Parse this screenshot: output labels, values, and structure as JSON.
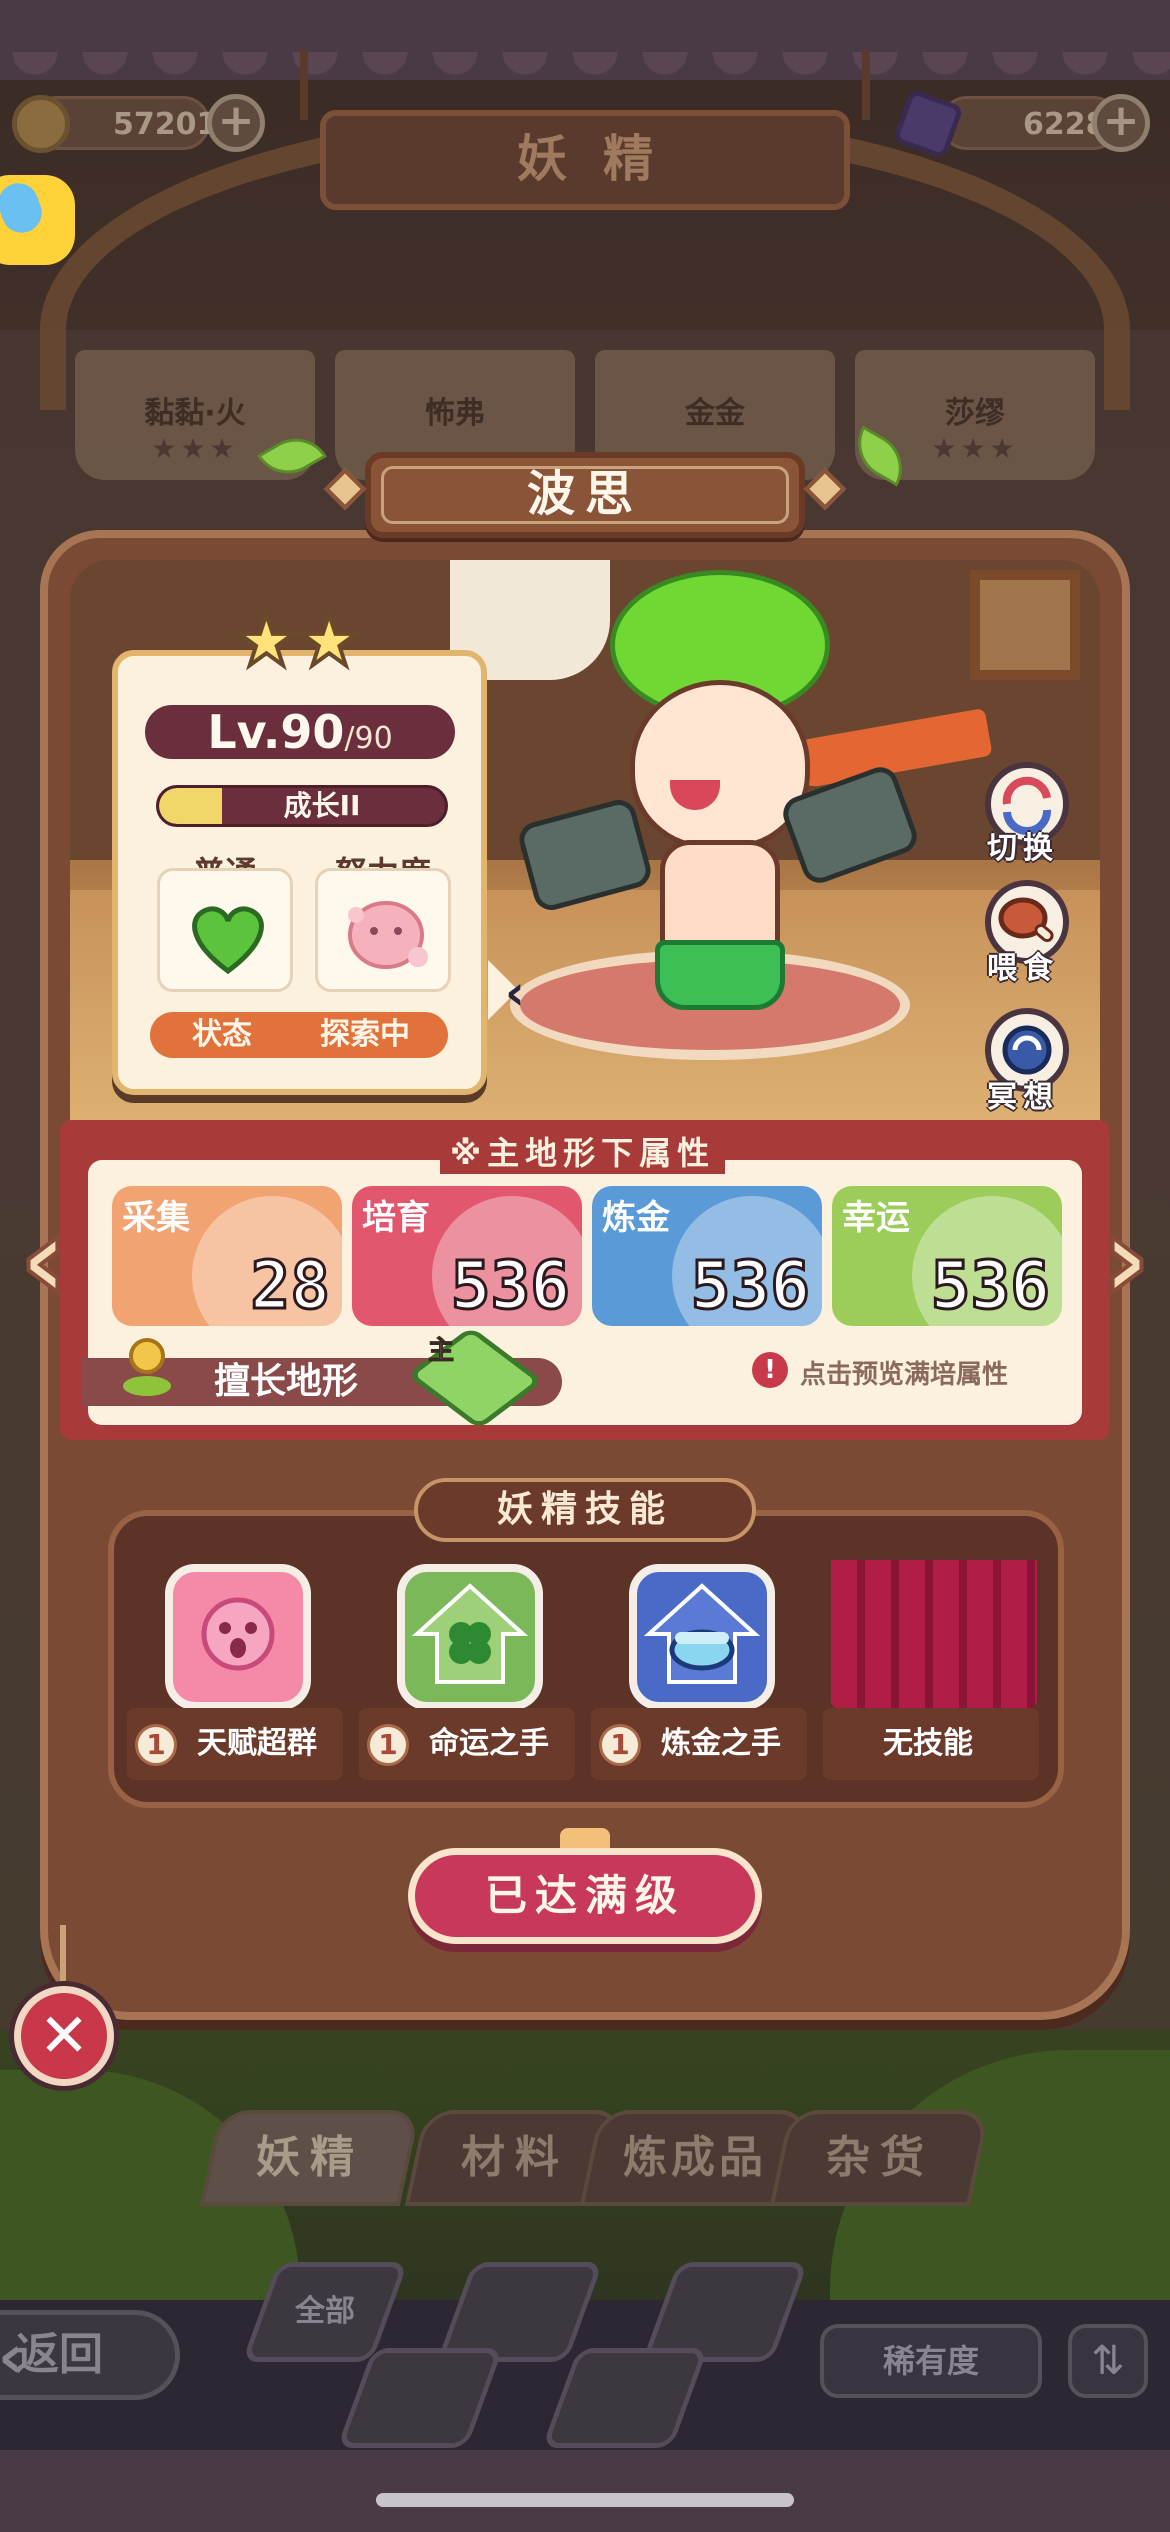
{
  "header": {
    "title": "妖精",
    "coins": "57201",
    "gems": "6228"
  },
  "top_tabs": [
    {
      "name": "黏黏·火",
      "stars": "★★★"
    },
    {
      "name": "怖弗",
      "stars": ""
    },
    {
      "name": "金金",
      "stars": ""
    },
    {
      "name": "莎缪",
      "stars": "★★★"
    }
  ],
  "fairy": {
    "name": "波思",
    "stars": "★★",
    "level": "Lv.90",
    "level_max": "/90",
    "growth": {
      "label": "成长II",
      "fill": 0.22
    },
    "type_label": "普通",
    "effort_label": "努力度",
    "state_label": "状态",
    "state_value": "探索中"
  },
  "actions": [
    {
      "key": "switch",
      "label": "切换",
      "icon": "swap-icon"
    },
    {
      "key": "feed",
      "label": "喂食",
      "icon": "meat-icon"
    },
    {
      "key": "meditate",
      "label": "冥想",
      "icon": "meditate-icon"
    }
  ],
  "attributes": {
    "heading": "※主地形下属性",
    "stats": [
      {
        "label": "采集",
        "value": "28",
        "color": "#f2a372"
      },
      {
        "label": "培育",
        "value": "536",
        "color": "#e2566e"
      },
      {
        "label": "炼金",
        "value": "536",
        "color": "#5a9ad6"
      },
      {
        "label": "幸运",
        "value": "536",
        "color": "#9ccc5a"
      }
    ],
    "terrain_label": "擅长地形",
    "terrain_badge": "主",
    "preview_hint": "点击预览满培属性"
  },
  "skills": {
    "title": "妖精技能",
    "items": [
      {
        "level": "1",
        "name": "天赋超群",
        "icon": "star-face-icon",
        "color": "#f48aa8"
      },
      {
        "level": "1",
        "name": "命运之手",
        "icon": "clover-icon",
        "color": "#7ab85a"
      },
      {
        "level": "1",
        "name": "炼金之手",
        "icon": "cauldron-icon",
        "color": "#4a6ac8"
      },
      {
        "level": "",
        "name": "无技能",
        "icon": "curtain-icon",
        "color": "#b01e48"
      }
    ]
  },
  "max_button": "已达满级",
  "bottom_tabs": [
    "妖精",
    "材料",
    "炼成品",
    "杂货"
  ],
  "bottom_nav": {
    "back": "返回",
    "filter_all": "全部",
    "rarity": "稀有度"
  }
}
